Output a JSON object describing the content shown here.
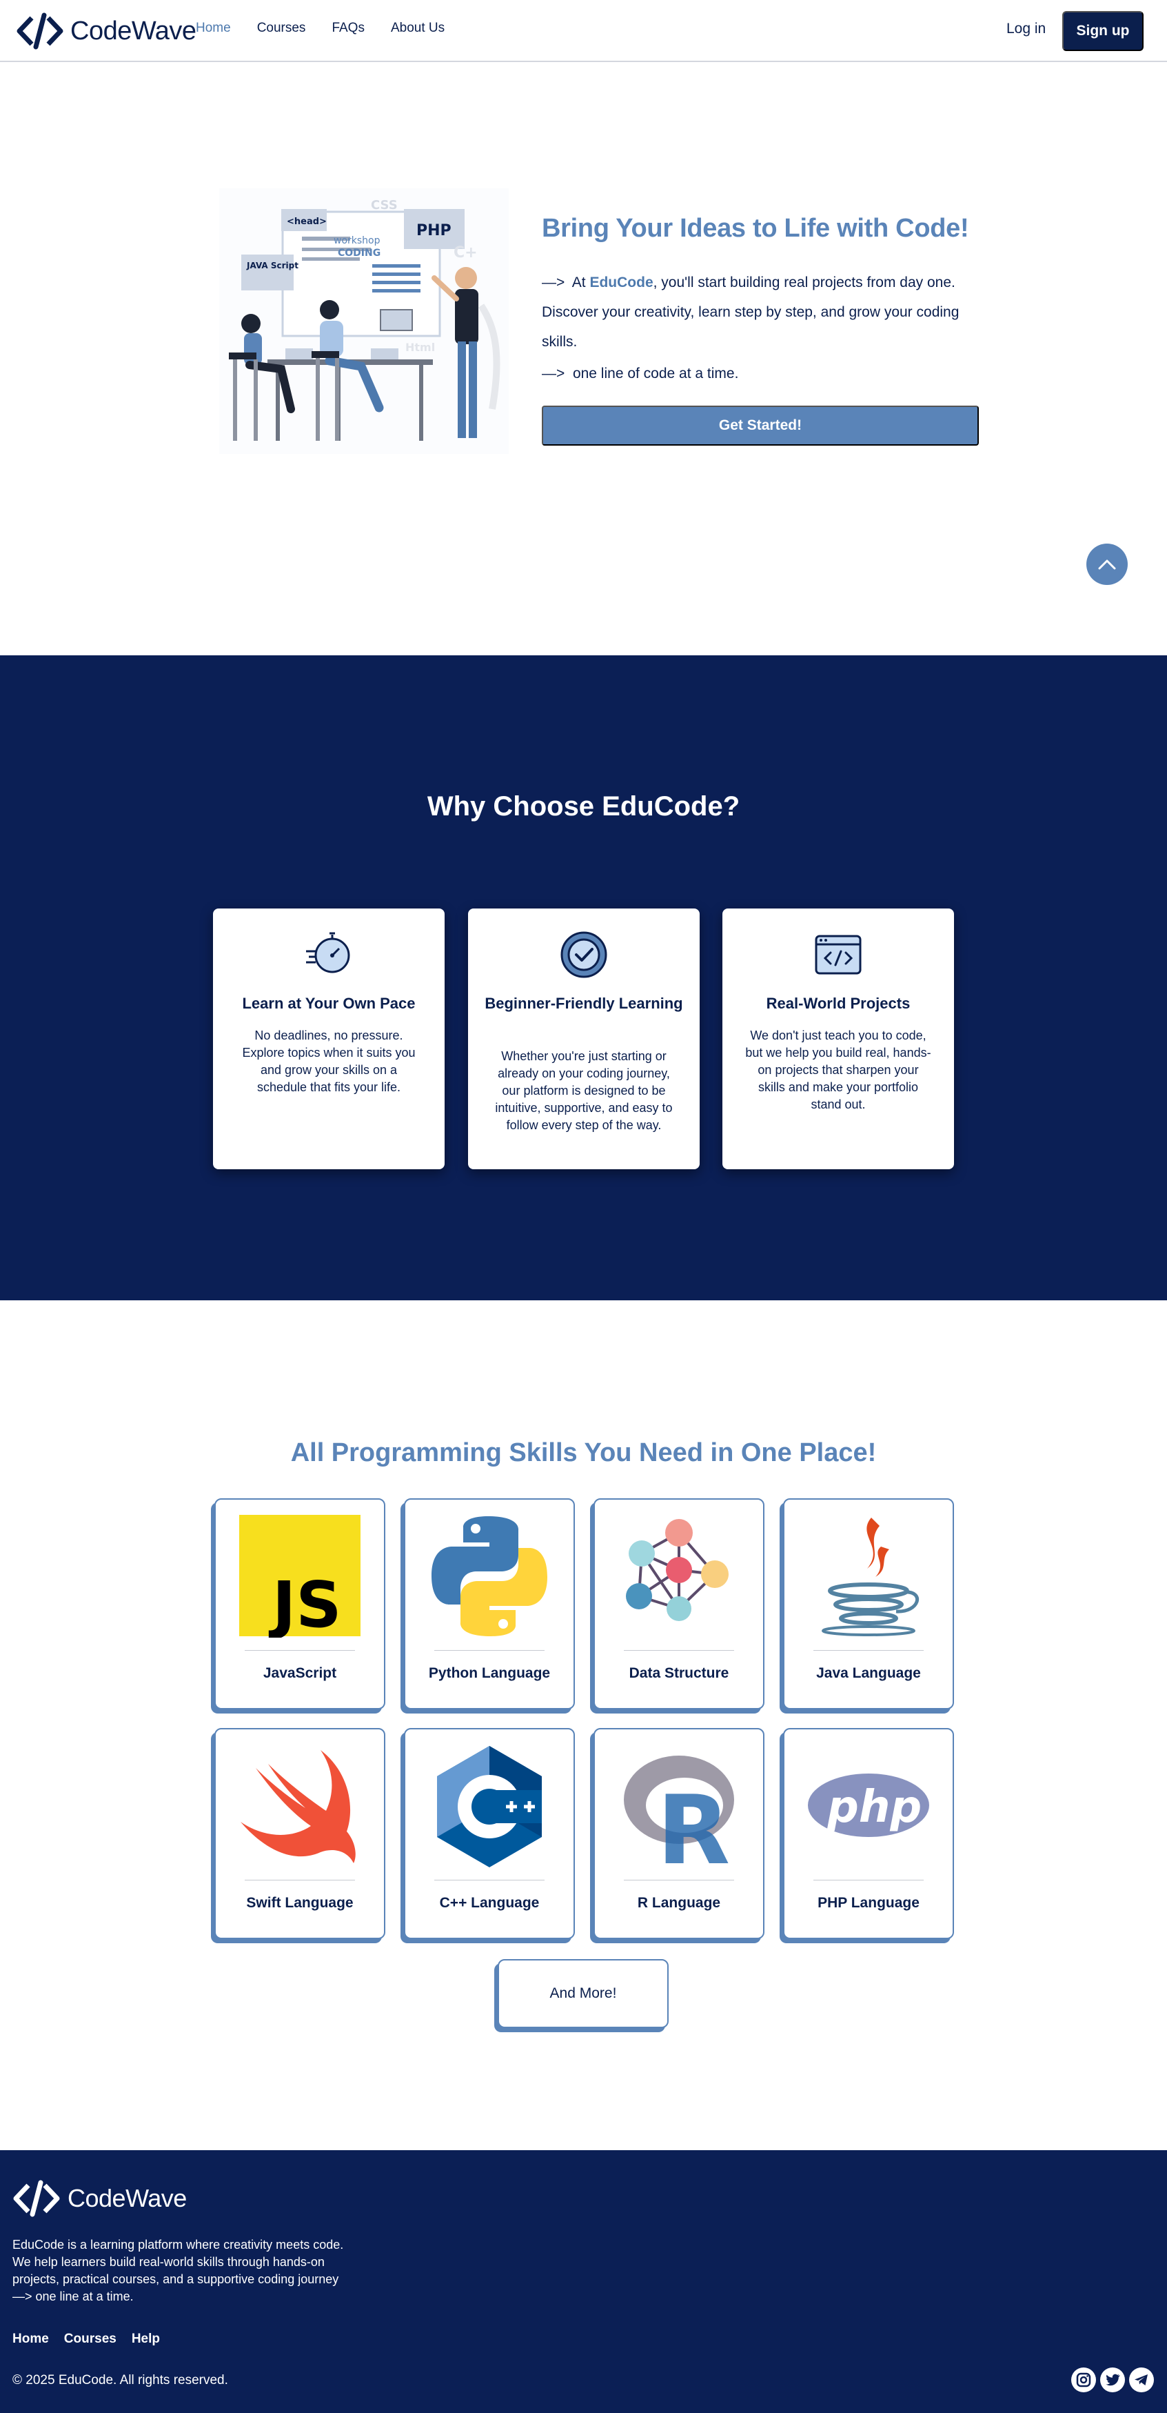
{
  "nav": {
    "brand": "CodeWave",
    "links": [
      {
        "label": "Home"
      },
      {
        "label": "Courses"
      },
      {
        "label": "FAQs"
      },
      {
        "label": "About Us"
      }
    ],
    "login": "Log in",
    "signup": "Sign up"
  },
  "hero": {
    "title": "Bring Your Ideas to Life with Code!",
    "arrow": "—>",
    "text_before": "At ",
    "brand": "EduCode",
    "text_after": ", you'll start building real projects from day one. Discover your creativity, learn step by step, and grow your coding skills.",
    "line2": "one line of code at a time.",
    "cta": "Get Started!",
    "illustration_labels": [
      "<head>",
      "PHP",
      "CSS",
      "workshop",
      "CODING",
      "JAVA Script",
      "Html",
      "C+"
    ]
  },
  "why": {
    "title": "Why Choose EduCode?",
    "cards": [
      {
        "icon": "speed-clock-icon",
        "title": "Learn at Your Own Pace",
        "text": "No deadlines, no pressure. Explore topics when it suits you and grow your skills on a schedule that fits your life."
      },
      {
        "icon": "check-badge-icon",
        "title": "Beginner-Friendly Learning",
        "text": "Whether you're just starting or already on your coding journey, our platform is designed to be intuitive, supportive, and easy to follow every step of the way."
      },
      {
        "icon": "code-window-icon",
        "title": "Real-World Projects",
        "text": "We don't just teach you to code, but we help you build real, hands-on projects that sharpen your skills and make your portfolio stand out."
      }
    ]
  },
  "skills": {
    "title": "All Programming Skills You Need in One Place!",
    "items": [
      {
        "icon": "javascript-logo-icon",
        "label": "JavaScript"
      },
      {
        "icon": "python-logo-icon",
        "label": "Python Language"
      },
      {
        "icon": "data-structure-graph-icon",
        "label": "Data Structure"
      },
      {
        "icon": "java-logo-icon",
        "label": "Java Language"
      },
      {
        "icon": "swift-logo-icon",
        "label": "Swift Language"
      },
      {
        "icon": "cpp-logo-icon",
        "label": "C++ Language"
      },
      {
        "icon": "r-logo-icon",
        "label": "R Language"
      },
      {
        "icon": "php-logo-icon",
        "label": "PHP Language"
      }
    ],
    "more": "And More!",
    "js_text": "JS",
    "php_text": "php",
    "r_text": "R"
  },
  "footer": {
    "brand": "CodeWave",
    "desc_1": "EduCode is a learning platform where creativity meets code.",
    "desc_2": "We help learners build real-world skills through hands-on",
    "desc_3": "projects, practical courses, and a supportive coding journey",
    "desc_4": "—> one line at a time.",
    "links": [
      {
        "label": "Home"
      },
      {
        "label": "Courses"
      },
      {
        "label": "Help"
      }
    ],
    "copyright": "© 2025 EduCode. All rights reserved.",
    "socials": [
      "instagram-icon",
      "twitter-icon",
      "telegram-icon"
    ]
  },
  "colors": {
    "navy": "#0b1f55",
    "accent": "#5a84b8",
    "text": "#0b1f4d"
  }
}
